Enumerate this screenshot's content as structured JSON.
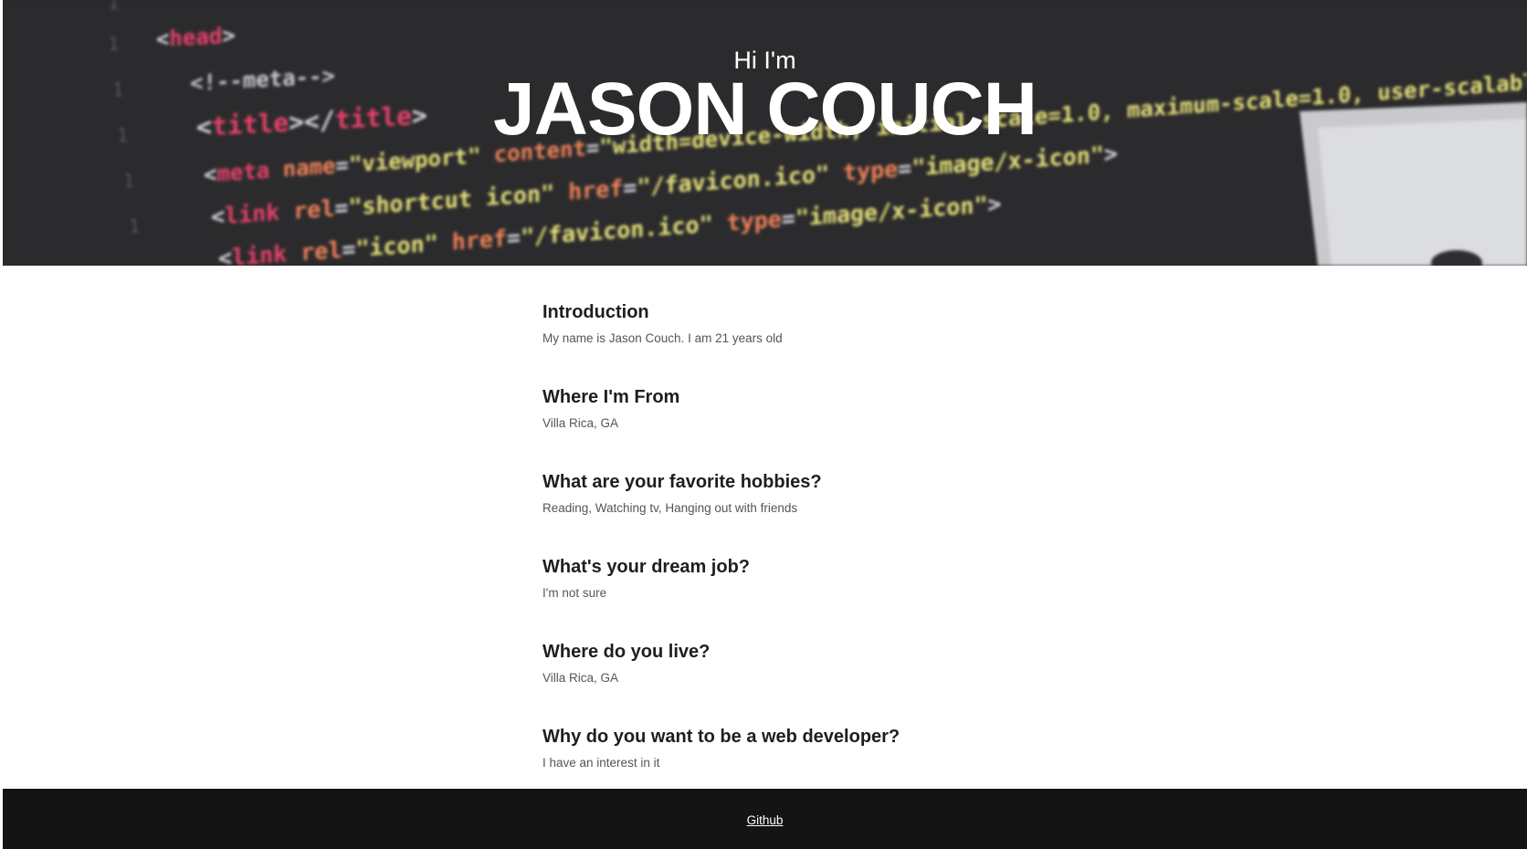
{
  "hero": {
    "greeting": "Hi I'm",
    "name": "JASON COUCH"
  },
  "sections": [
    {
      "heading": "Introduction",
      "text": "My name is Jason Couch. I am 21 years old"
    },
    {
      "heading": "Where I'm From",
      "text": "Villa Rica, GA"
    },
    {
      "heading": "What are your favorite hobbies?",
      "text": "Reading, Watching tv, Hanging out with friends"
    },
    {
      "heading": "What's your dream job?",
      "text": "I'm not sure"
    },
    {
      "heading": "Where do you live?",
      "text": "Villa Rica, GA"
    },
    {
      "heading": "Why do you want to be a web developer?",
      "text": "I have an interest in it"
    }
  ],
  "footer": {
    "link_label": "Github"
  },
  "colors": {
    "hero_bg": "#2b2b2d",
    "footer_bg": "#141414",
    "code_pink": "#e8416a",
    "code_yellow": "#e8e37a",
    "code_orange": "#f0825a",
    "code_white": "#d8d8e0"
  }
}
